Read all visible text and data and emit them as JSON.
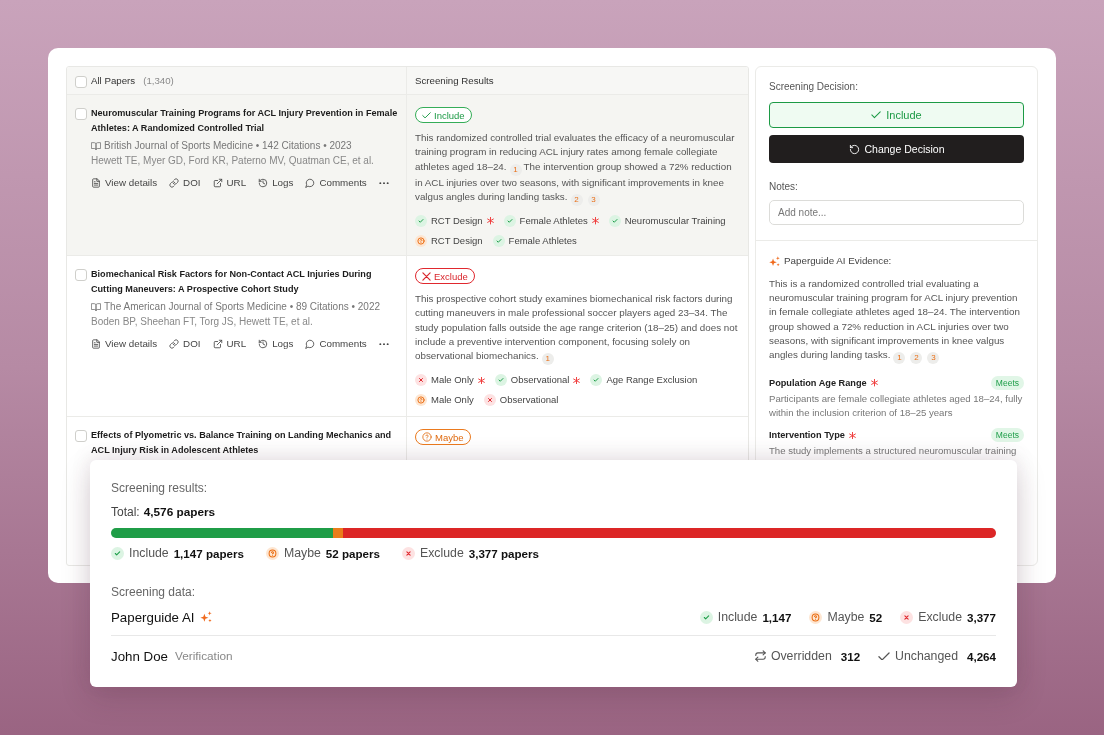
{
  "papers_table": {
    "header": {
      "checked": false,
      "label": "All Papers",
      "count": "(1,340)",
      "results_label": "Screening Results"
    },
    "rows": [
      {
        "selected": true,
        "checked": false,
        "title": "Neuromuscular Training Programs for ACL Injury Prevention in Female Athletes: A Randomized Controlled Trial",
        "meta": "British Journal of Sports Medicine • 142 Citations • 2023",
        "authors": "Hewett TE, Myer GD, Ford KR, Paterno MV, Quatman CE, et al.",
        "actions": [
          {
            "kind": "details",
            "label": "View details"
          },
          {
            "kind": "doi",
            "label": "DOI"
          },
          {
            "kind": "url",
            "label": "URL"
          },
          {
            "kind": "logs",
            "label": "Logs"
          },
          {
            "kind": "comments",
            "label": "Comments"
          },
          {
            "kind": "more"
          }
        ],
        "decision": {
          "kind": "include",
          "label": "Include"
        },
        "summary": [
          {
            "kind": "text",
            "text": "This randomized controlled trial evaluates the efficacy of a neuromuscular training program in reducing ACL injury rates among female collegiate athletes aged 18–24."
          },
          {
            "kind": "cite",
            "label": "1"
          },
          {
            "kind": "text",
            "text": "The intervention group showed a 72% reduction in ACL injuries over two seasons, with significant improvements in knee valgus angles during landing tasks."
          },
          {
            "kind": "cite",
            "label": "2"
          },
          {
            "kind": "cite",
            "label": "3"
          }
        ],
        "criteria": [
          [
            {
              "kind": "include",
              "label": "RCT Design",
              "required": true
            },
            {
              "kind": "include",
              "label": "Female Athletes",
              "required": true
            },
            {
              "kind": "include",
              "label": "Neuromuscular Training",
              "required": false
            }
          ],
          [
            {
              "kind": "maybe",
              "label": "RCT Design",
              "required": false
            },
            {
              "kind": "include",
              "label": "Female Athletes",
              "required": false
            }
          ]
        ]
      },
      {
        "selected": false,
        "checked": false,
        "title": "Biomechanical Risk Factors for Non-Contact ACL Injuries During Cutting Maneuvers: A Prospective Cohort Study",
        "meta": "The American Journal of Sports Medicine • 89 Citations • 2022",
        "authors": "Boden BP, Sheehan FT, Torg JS, Hewett TE, et al.",
        "actions": [
          {
            "kind": "details",
            "label": "View details"
          },
          {
            "kind": "doi",
            "label": "DOI"
          },
          {
            "kind": "url",
            "label": "URL"
          },
          {
            "kind": "logs",
            "label": "Logs"
          },
          {
            "kind": "comments",
            "label": "Comments"
          },
          {
            "kind": "more"
          }
        ],
        "decision": {
          "kind": "exclude",
          "label": "Exclude"
        },
        "summary": [
          {
            "kind": "text",
            "text": "This prospective cohort study examines biomechanical risk factors during cutting maneuvers in male professional soccer players aged 23–34. The study population falls outside the age range criterion (18–25) and does not include a preventive intervention component, focusing solely on observational biomechanics."
          },
          {
            "kind": "cite",
            "label": "1"
          }
        ],
        "criteria": [
          [
            {
              "kind": "exclude",
              "label": "Male Only",
              "required": true
            },
            {
              "kind": "include",
              "label": "Observational",
              "required": true
            },
            {
              "kind": "include",
              "label": "Age Range Exclusion",
              "required": false
            }
          ],
          [
            {
              "kind": "maybe",
              "label": "Male Only",
              "required": false
            },
            {
              "kind": "exclude",
              "label": "Observational",
              "required": false
            }
          ]
        ]
      },
      {
        "selected": false,
        "checked": false,
        "title": "Effects of Plyometric vs. Balance Training on Landing Mechanics and ACL Injury Risk in Adolescent Athletes",
        "decision": {
          "kind": "maybe",
          "label": "Maybe"
        }
      }
    ]
  },
  "decision_panel": {
    "label": "Screening Decision:",
    "decision": {
      "kind": "include",
      "label": "Include"
    },
    "change_label": "Change Decision",
    "notes_label": "Notes:",
    "notes_placeholder": "Add note..."
  },
  "evidence_panel": {
    "title": "Paperguide AI Evidence:",
    "summary": [
      {
        "kind": "text",
        "text": "This is a randomized controlled trial evaluating a neuromuscular training program for ACL injury prevention in female collegiate athletes aged 18–24. The intervention group showed a 72% reduction in ACL injuries over two seasons, with significant improvements in knee valgus angles during landing tasks."
      },
      {
        "kind": "cite",
        "label": "1"
      },
      {
        "kind": "cite",
        "label": "2"
      },
      {
        "kind": "cite",
        "label": "3"
      }
    ],
    "criteria": [
      {
        "name": "Population Age Range",
        "required": true,
        "verdict": {
          "kind": "meets",
          "label": "Meets"
        },
        "detail": "Participants are female collegiate athletes aged 18–24, fully within the inclusion criterion of 18–25 years"
      },
      {
        "name": "Intervention Type",
        "required": true,
        "verdict": {
          "kind": "meets",
          "label": "Meets"
        },
        "detail": "The study implements a structured neuromuscular training"
      }
    ]
  },
  "screening_summary": {
    "title": "Screening results:",
    "total_label": "Total:",
    "total_value": "4,576 papers",
    "breakdown": [
      {
        "kind": "include",
        "label": "Include",
        "value": "1,147 papers",
        "level": 0.251
      },
      {
        "kind": "maybe",
        "label": "Maybe",
        "value": "52 papers",
        "level": 0.011
      },
      {
        "kind": "exclude",
        "label": "Exclude",
        "value": "3,377 papers",
        "level": 0.738
      }
    ],
    "data_title": "Screening data:",
    "sources": [
      {
        "kind": "ai",
        "name": "Paperguide AI",
        "stats": [
          {
            "kind": "include",
            "label": "Include",
            "value": "1,147"
          },
          {
            "kind": "maybe",
            "label": "Maybe",
            "value": "52"
          },
          {
            "kind": "exclude",
            "label": "Exclude",
            "value": "3,377"
          }
        ]
      },
      {
        "kind": "person",
        "name": "John Doe",
        "note": "Verification",
        "stats": [
          {
            "kind": "overridden",
            "label": "Overridden",
            "value": "312"
          },
          {
            "kind": "unchanged",
            "label": "Unchanged",
            "value": "4,264"
          }
        ]
      }
    ]
  }
}
